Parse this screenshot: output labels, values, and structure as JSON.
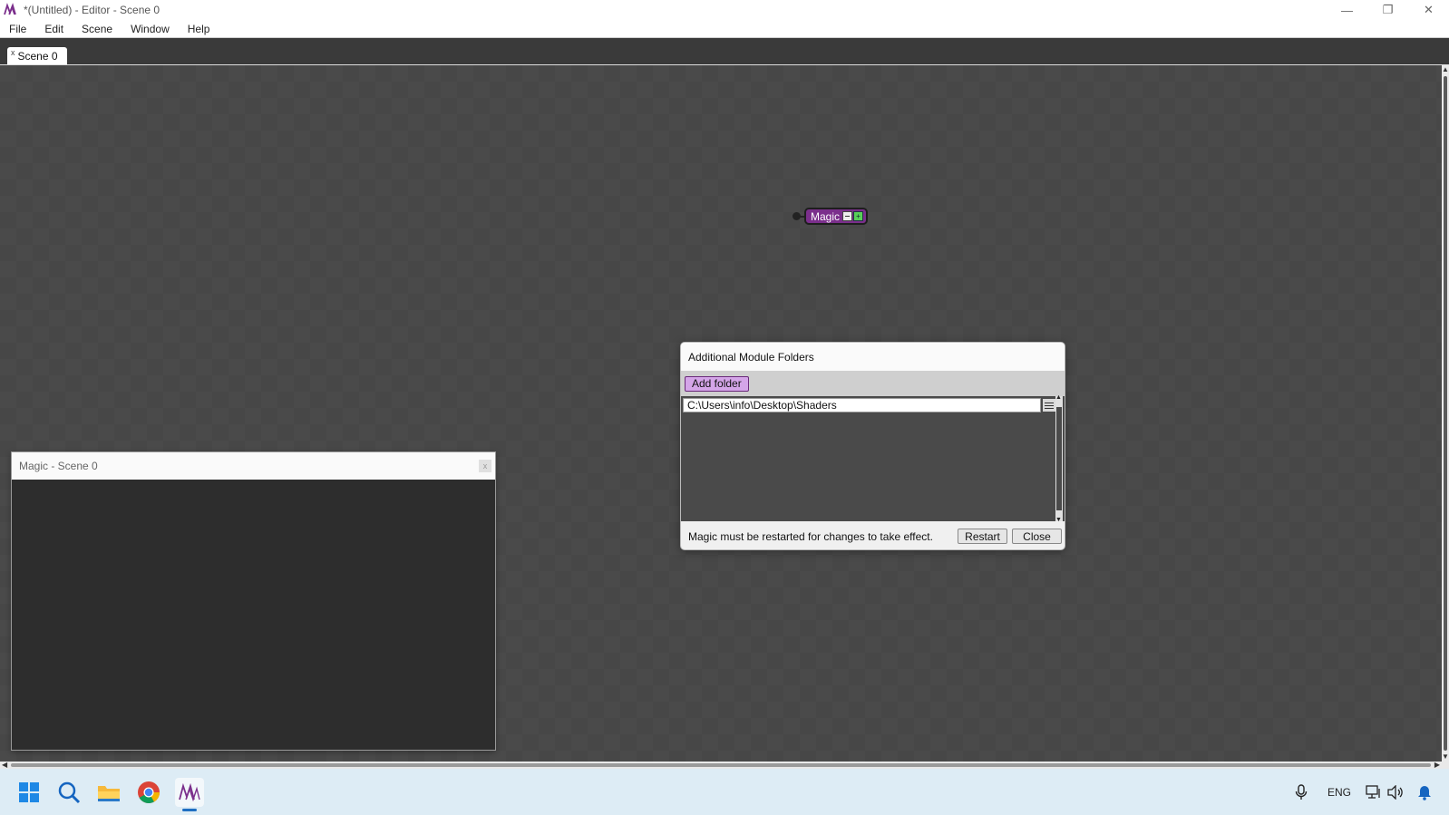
{
  "window": {
    "title": "*(Untitled) - Editor - Scene 0",
    "controls": {
      "minimize": "—",
      "restore": "❐",
      "close": "✕"
    }
  },
  "menu": {
    "items": [
      {
        "label": "File"
      },
      {
        "label": "Edit"
      },
      {
        "label": "Scene"
      },
      {
        "label": "Window"
      },
      {
        "label": "Help"
      }
    ]
  },
  "tabs": [
    {
      "close": "x",
      "label": "Scene 0"
    }
  ],
  "node": {
    "label": "Magic",
    "color": "#7b2f8c"
  },
  "dialog": {
    "title": "Additional Module Folders",
    "add_folder_label": "Add folder",
    "folders": [
      "C:\\Users\\info\\Desktop\\Shaders"
    ],
    "footer_text": "Magic must be restarted for changes to take effect.",
    "restart_label": "Restart",
    "close_label": "Close"
  },
  "preview_window": {
    "title": "Magic - Scene 0",
    "close_label": "x"
  },
  "taskbar": {
    "apps": [
      {
        "icon": "windows-start-icon"
      },
      {
        "icon": "search-icon"
      },
      {
        "icon": "file-explorer-icon"
      },
      {
        "icon": "chrome-icon"
      },
      {
        "icon": "magic-app-icon",
        "active": true
      }
    ],
    "tray": {
      "language": "ENG"
    }
  },
  "colors": {
    "accent": "#7b2f8c",
    "button_accent": "#d4a5e8",
    "canvas": "#4a4a4a",
    "taskbar": "#ddecf5"
  }
}
